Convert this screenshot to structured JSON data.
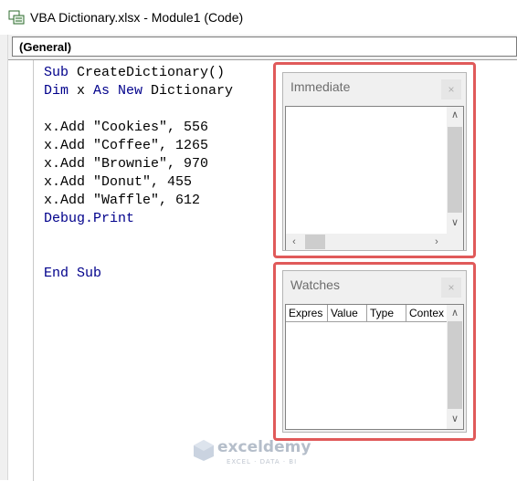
{
  "window": {
    "title": "VBA Dictionary.xlsx - Module1 (Code)",
    "icon": "vba-module-icon"
  },
  "combo": {
    "value": "(General)"
  },
  "code": {
    "line1": {
      "kw": "Sub",
      "rest": " CreateDictionary()"
    },
    "line2": {
      "kw1": "Dim",
      "mid1": " x ",
      "kw2": "As New",
      "rest": " Dictionary"
    },
    "line4": "x.Add \"Cookies\", 556",
    "line5": "x.Add \"Coffee\", 1265",
    "line6": "x.Add \"Brownie\", 970",
    "line7": "x.Add \"Donut\", 455",
    "line8": "x.Add \"Waffle\", 612",
    "line9": "Debug.Print",
    "line12": "End Sub"
  },
  "immediate": {
    "title": "Immediate",
    "close": "×"
  },
  "watches": {
    "title": "Watches",
    "close": "×",
    "columns": [
      "Expres",
      "Value",
      "Type",
      "Contex"
    ]
  },
  "colors": {
    "highlight": "#e05a5a",
    "keyword": "#00008b"
  },
  "watermark": {
    "brand": "exceldemy",
    "tagline": "EXCEL · DATA · BI"
  }
}
